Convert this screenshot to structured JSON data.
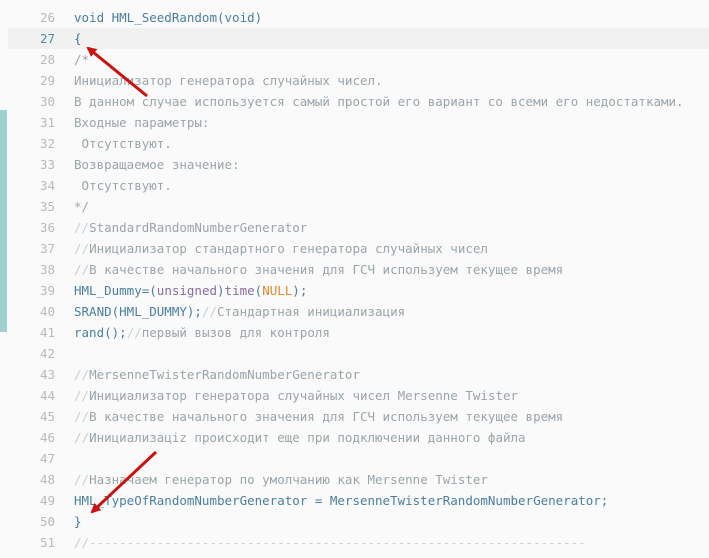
{
  "editor": {
    "colors": {
      "background": "#fafafa",
      "current_line": "#f1f1f1",
      "gutter_marker": "#9fd0d0",
      "arrow": "#cc1111"
    },
    "lines": [
      {
        "n": "26",
        "segs": [
          {
            "t": "void HML_SeedRandom(void)",
            "c": "kw"
          }
        ]
      },
      {
        "n": "27",
        "current": true,
        "segs": [
          {
            "t": "{",
            "c": "caret"
          }
        ]
      },
      {
        "n": "28",
        "segs": [
          {
            "t": "/*",
            "c": "cm"
          }
        ]
      },
      {
        "n": "29",
        "segs": [
          {
            "t": "Инициализатор генератора случайных чисел.",
            "c": "cm"
          }
        ]
      },
      {
        "n": "30",
        "segs": [
          {
            "t": "В данном случае используется самый простой его вариант со всеми его недостатками.",
            "c": "cm"
          }
        ]
      },
      {
        "n": "31",
        "segs": [
          {
            "t": "Входные параметры:",
            "c": "cm"
          }
        ]
      },
      {
        "n": "32",
        "segs": [
          {
            "t": " Отсутствуют.",
            "c": "cm"
          }
        ]
      },
      {
        "n": "33",
        "segs": [
          {
            "t": "Возвращаемое значение:",
            "c": "cm"
          }
        ]
      },
      {
        "n": "34",
        "segs": [
          {
            "t": " Отсутствуют.",
            "c": "cm"
          }
        ]
      },
      {
        "n": "35",
        "segs": [
          {
            "t": "*/",
            "c": "cm"
          }
        ]
      },
      {
        "n": "36",
        "segs": [
          {
            "t": "//",
            "c": "cmdim"
          },
          {
            "t": "StandardRandomNumberGenerator",
            "c": "cm"
          }
        ]
      },
      {
        "n": "37",
        "segs": [
          {
            "t": "//",
            "c": "cmdim"
          },
          {
            "t": "Инициализатор стандартного генератора случайных чисел",
            "c": "cm"
          }
        ]
      },
      {
        "n": "38",
        "segs": [
          {
            "t": "//",
            "c": "cmdim"
          },
          {
            "t": "В качестве начального значения для ГСЧ используем текущее время",
            "c": "cm"
          }
        ]
      },
      {
        "n": "39",
        "segs": [
          {
            "t": "HML_Dummy=(",
            "c": "kw"
          },
          {
            "t": "unsigned",
            "c": "type"
          },
          {
            "t": ")",
            "c": "kw"
          },
          {
            "t": "time",
            "c": "type"
          },
          {
            "t": "(",
            "c": "kw"
          },
          {
            "t": "NULL",
            "c": "const"
          },
          {
            "t": ");",
            "c": "kw"
          }
        ]
      },
      {
        "n": "40",
        "segs": [
          {
            "t": "SRAND(HML_DUMMY);",
            "c": "kw"
          },
          {
            "t": "//",
            "c": "cmdim"
          },
          {
            "t": "Стандартная инициализация",
            "c": "cm"
          }
        ]
      },
      {
        "n": "41",
        "segs": [
          {
            "t": "rand();",
            "c": "kw"
          },
          {
            "t": "//",
            "c": "cmdim"
          },
          {
            "t": "первый вызов для контроля",
            "c": "cm"
          }
        ]
      },
      {
        "n": "42",
        "segs": []
      },
      {
        "n": "43",
        "segs": [
          {
            "t": "//",
            "c": "cmdim"
          },
          {
            "t": "MersenneTwisterRandomNumberGenerator",
            "c": "cm"
          }
        ]
      },
      {
        "n": "44",
        "segs": [
          {
            "t": "//",
            "c": "cmdim"
          },
          {
            "t": "Инициализатор генератора случайных чисел Mersenne Twister",
            "c": "cm"
          }
        ]
      },
      {
        "n": "45",
        "segs": [
          {
            "t": "//",
            "c": "cmdim"
          },
          {
            "t": "В качестве начального значения для ГСЧ используем текущее время",
            "c": "cm"
          }
        ]
      },
      {
        "n": "46",
        "segs": [
          {
            "t": "//",
            "c": "cmdim"
          },
          {
            "t": "Инициализацiz происходит еще при подключении данного файла",
            "c": "cm"
          }
        ]
      },
      {
        "n": "47",
        "segs": []
      },
      {
        "n": "48",
        "segs": [
          {
            "t": "//",
            "c": "cmdim"
          },
          {
            "t": "Назначаем генератор по умолчанию как Mersenne Twister",
            "c": "cm"
          }
        ]
      },
      {
        "n": "49",
        "segs": [
          {
            "t": "HML_TypeOfRandomNumberGenerator = MersenneTwisterRandomNumberGenerator;",
            "c": "kw"
          }
        ]
      },
      {
        "n": "50",
        "segs": [
          {
            "t": "}",
            "c": "caret"
          }
        ]
      },
      {
        "n": "51",
        "segs": [
          {
            "t": "//------------------------------------------------------------------",
            "c": "cmdim"
          }
        ]
      }
    ]
  }
}
